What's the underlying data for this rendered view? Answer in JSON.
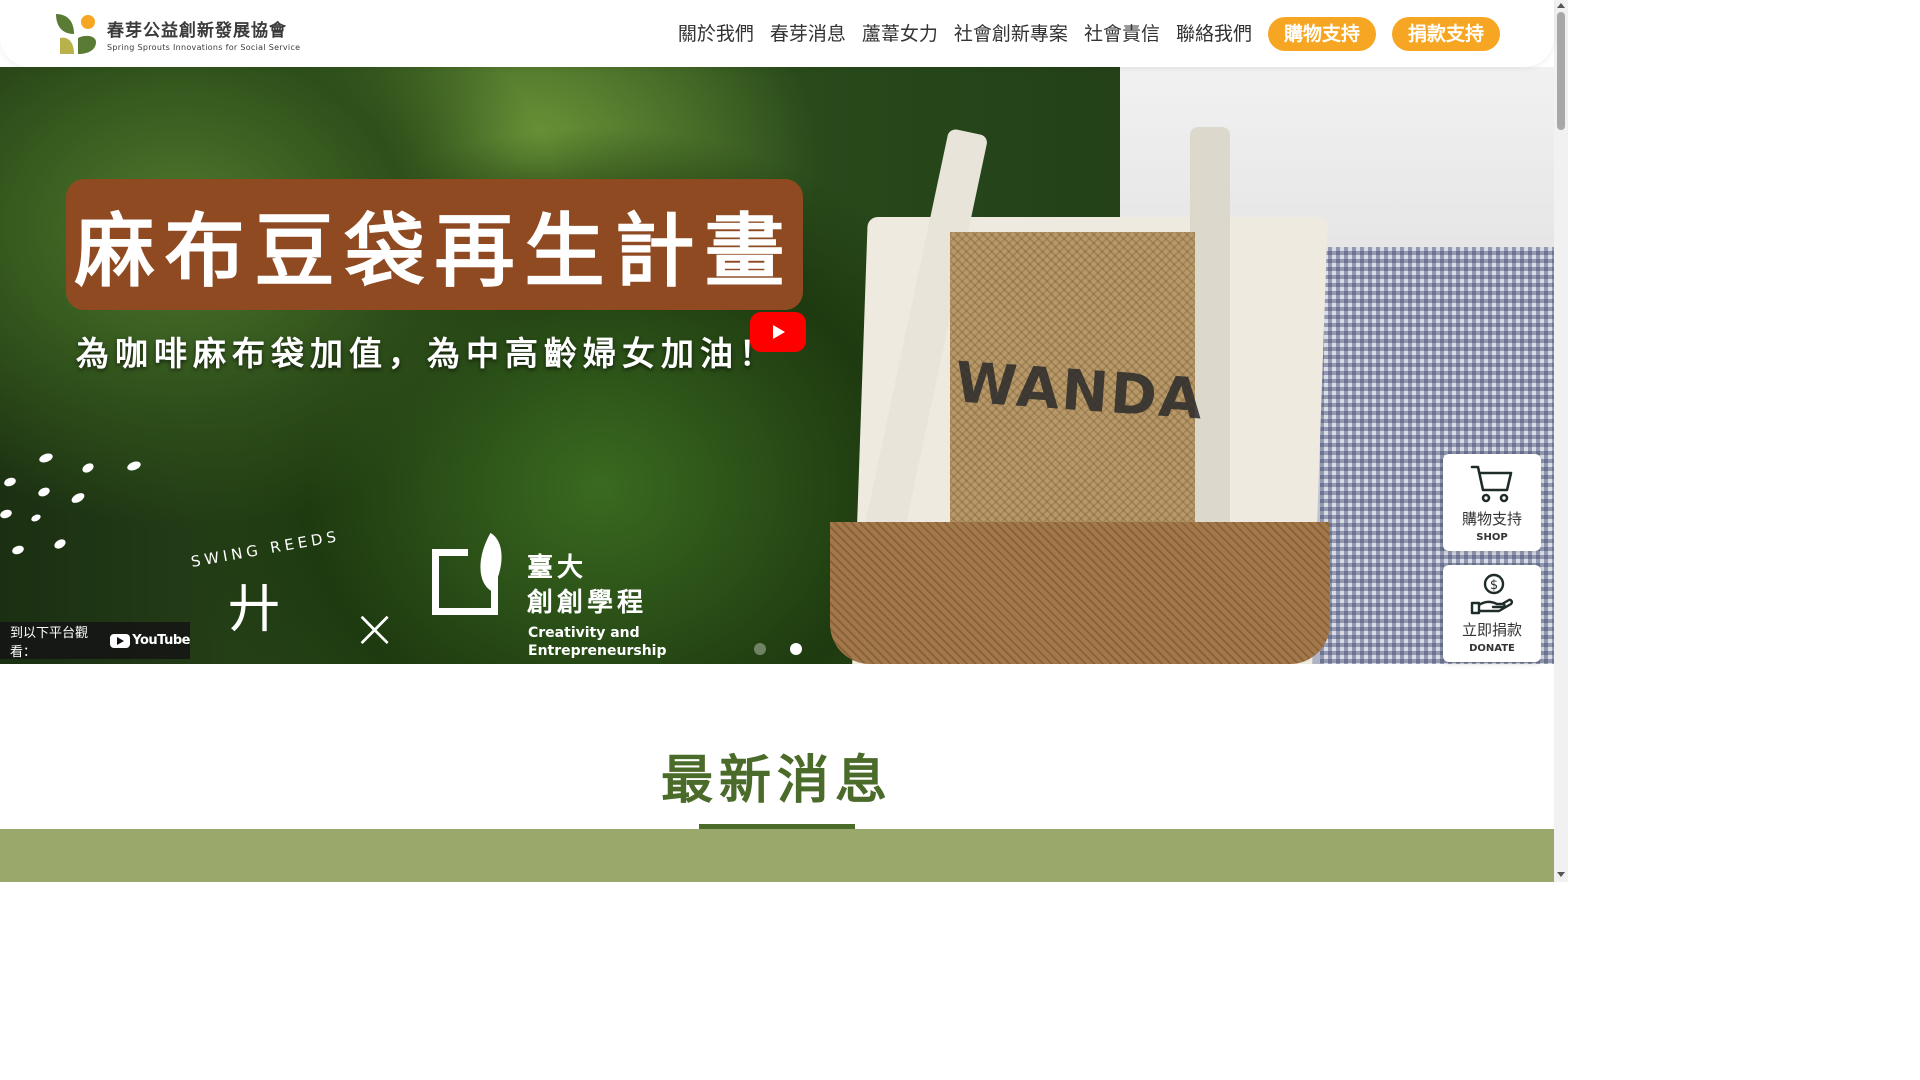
{
  "header": {
    "logo_zh": "春芽公益創新發展協會",
    "logo_en": "Spring Sprouts Innovations for Social Service",
    "nav": [
      "關於我們",
      "春芽消息",
      "蘆葦女力",
      "社會創新專案",
      "社會責信",
      "聯絡我們"
    ],
    "shop_button": "購物支持",
    "donate_button": "捐款支持",
    "accent_color": "#f6a623"
  },
  "hero": {
    "title": "麻布豆袋再生計畫",
    "subtitle": "為咖啡麻布袋加值，為中高齡婦女加油！",
    "bag_print": "WANDA",
    "swing_reeds_label": "SWING REEDS",
    "swing_reeds_glyph": "廾",
    "cross": "×",
    "partner_name_line1": "臺大",
    "partner_name_line2": "創創學程",
    "partner_en_line1": "Creativity and",
    "partner_en_line2": "Entrepreneurship",
    "watch_on_label": "到以下平台觀看：",
    "youtube_label": "YouTube",
    "carousel": {
      "total": 2,
      "active": 2
    }
  },
  "side_buttons": {
    "shop": {
      "zh": "購物支持",
      "en": "SHOP",
      "icon": "cart-icon"
    },
    "donate": {
      "zh": "立即捐款",
      "en": "DONATE",
      "icon": "donate-hand-icon"
    }
  },
  "news": {
    "title": "最新消息",
    "theme_color": "#4b6b2a",
    "band_color": "#9aa86c"
  }
}
